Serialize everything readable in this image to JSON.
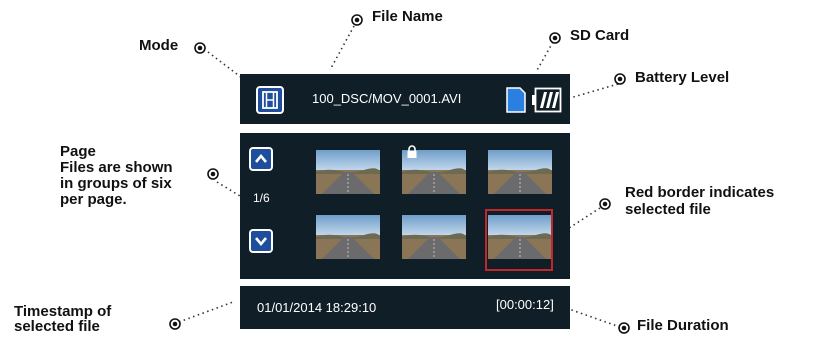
{
  "screen": {
    "file_name": "100_DSC/MOV_0001.AVI",
    "page_indicator": "1/6",
    "timestamp": "01/01/2014 18:29:10",
    "duration": "[00:00:12]"
  },
  "callouts": {
    "file_name": "File Name",
    "mode": "Mode",
    "sd_card": "SD Card",
    "battery": "Battery Level",
    "page_title": "Page",
    "page_desc_1": "Files are shown",
    "page_desc_2": "in groups of six",
    "page_desc_3": "per page.",
    "selected_1": "Red border indicates",
    "selected_2": "selected file",
    "timestamp_1": "Timestamp of",
    "timestamp_2": "selected file",
    "duration": "File Duration"
  },
  "icons": {
    "mode": "film-icon",
    "sd_card": "sd-card-icon",
    "battery": "battery-icon",
    "page_up": "chevron-up-icon",
    "page_down": "chevron-down-icon",
    "locked": "lock-icon",
    "callout_marker": "target-bullet-icon"
  },
  "colors": {
    "panel": "#101e28",
    "button_fill": "#1f4f9c",
    "sd_card": "#2a7fe0",
    "selection_border": "#c0282c"
  }
}
